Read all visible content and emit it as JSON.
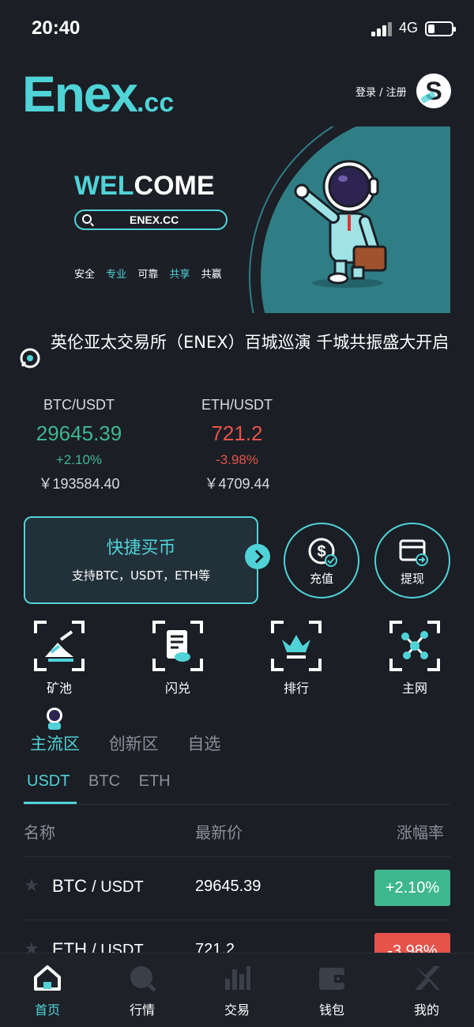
{
  "status": {
    "time": "20:40",
    "network": "4G"
  },
  "header": {
    "logo_main": "Enex",
    "logo_tld": ".cc",
    "login_label": "登录 / 注册",
    "avatar_letter": "S"
  },
  "banner": {
    "welcome_a": "WEL",
    "welcome_b": "COME",
    "search_text": "ENEX.CC",
    "tags": [
      "安全",
      "专业",
      "可靠",
      "共享",
      "共赢"
    ]
  },
  "notice": {
    "text": "英伦亚太交易所（ENEX）百城巡演 千城共振盛大开启"
  },
  "tickers": [
    {
      "pair": "BTC/USDT",
      "price": "29645.39",
      "change": "+2.10%",
      "cny": "￥193584.40"
    },
    {
      "pair": "ETH/USDT",
      "price": "721.2",
      "change": "-3.98%",
      "cny": "￥4709.44"
    }
  ],
  "quick_buy": {
    "title": "快捷买币",
    "subtitle": "支持BTC，USDT，ETH等"
  },
  "actions": {
    "deposit": "充值",
    "withdraw": "提现"
  },
  "features": [
    {
      "label": "矿池",
      "icon": "mining-pool-icon"
    },
    {
      "label": "闪兑",
      "icon": "flash-exchange-icon"
    },
    {
      "label": "排行",
      "icon": "ranking-crown-icon"
    },
    {
      "label": "主网",
      "icon": "mainnet-network-icon"
    }
  ],
  "zone_tabs": [
    "主流区",
    "创新区",
    "自选"
  ],
  "quote_tabs": [
    "USDT",
    "BTC",
    "ETH"
  ],
  "table": {
    "headers": [
      "名称",
      "最新价",
      "涨幅率"
    ],
    "rows": [
      {
        "base": "BTC",
        "quote": "/ USDT",
        "price": "29645.39",
        "change": "+2.10%"
      },
      {
        "base": "ETH",
        "quote": "/ USDT",
        "price": "721.2",
        "change": "-3.98%"
      }
    ]
  },
  "nav": [
    "首页",
    "行情",
    "交易",
    "钱包",
    "我的"
  ],
  "colors": {
    "accent": "#4fd3d7",
    "up": "#3fb78e",
    "down": "#e5534b",
    "background": "#1b1e25"
  }
}
